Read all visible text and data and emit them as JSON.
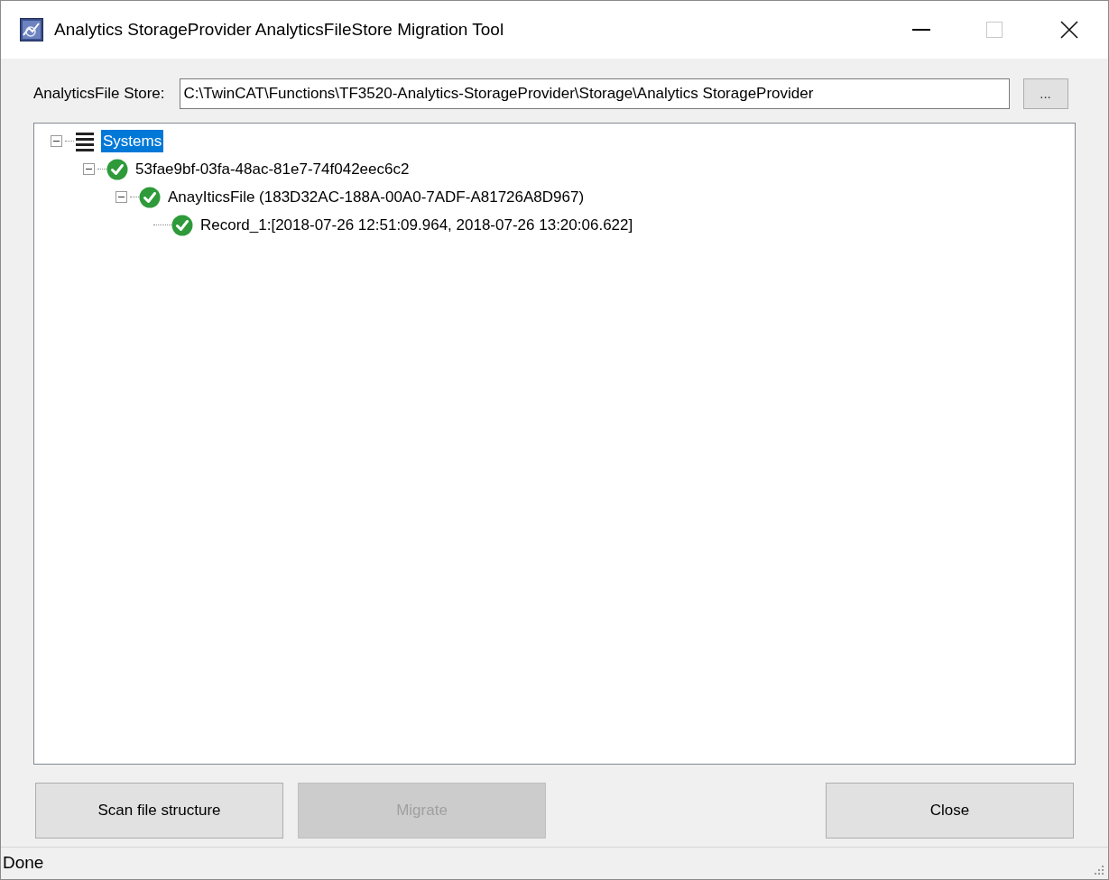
{
  "window": {
    "title": "Analytics StorageProvider AnalyticsFileStore Migration Tool"
  },
  "store": {
    "label": "AnalyticsFile Store:",
    "value": "C:\\TwinCAT\\Functions\\TF3520-Analytics-StorageProvider\\Storage\\Analytics StorageProvider",
    "browse": "..."
  },
  "tree": [
    {
      "label": "Systems",
      "kind": "list",
      "selected": true,
      "expanded": true,
      "children": [
        {
          "label": "53fae9bf-03fa-48ac-81e7-74f042eec6c2",
          "kind": "ok",
          "selected": false,
          "expanded": true,
          "children": [
            {
              "label": "AnayIticsFile (183D32AC-188A-00A0-7ADF-A81726A8D967)",
              "kind": "ok",
              "selected": false,
              "expanded": true,
              "children": [
                {
                  "label": "Record_1:[2018-07-26 12:51:09.964, 2018-07-26 13:20:06.622]",
                  "kind": "ok",
                  "selected": false
                }
              ]
            }
          ]
        }
      ]
    }
  ],
  "buttons": [
    {
      "label": "Scan file structure",
      "disabled": false
    },
    {
      "label": "Migrate",
      "disabled": true
    },
    {
      "label": "Close",
      "disabled": false
    }
  ],
  "status_bar": {
    "text": "Done"
  }
}
